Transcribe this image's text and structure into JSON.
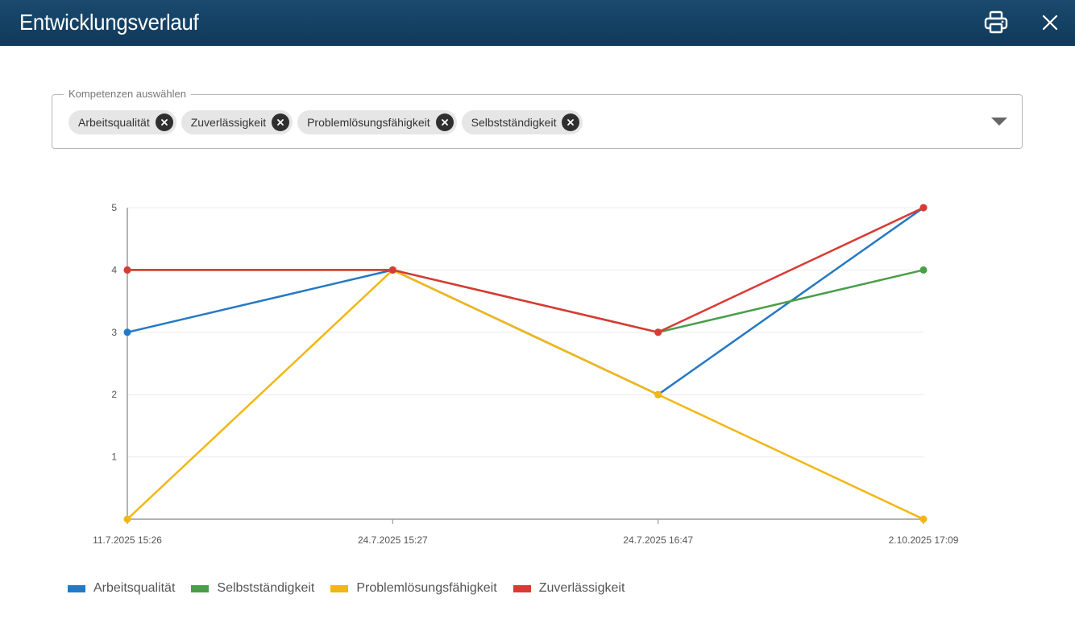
{
  "header": {
    "title": "Entwicklungsverlauf",
    "print_icon": "printer-icon",
    "close_icon": "close-icon"
  },
  "selector": {
    "legend": "Kompetenzen auswählen",
    "chips": [
      {
        "label": "Arbeitsqualität"
      },
      {
        "label": "Zuverlässigkeit"
      },
      {
        "label": "Problemlösungsfähigkeit"
      },
      {
        "label": "Selbstständigkeit"
      }
    ],
    "dropdown_icon": "triangle-down-icon"
  },
  "chart_data": {
    "type": "line",
    "x": [
      "11.7.2025 15:26",
      "24.7.2025 15:27",
      "24.7.2025 16:47",
      "2.10.2025 17:09"
    ],
    "ylim": [
      0,
      5
    ],
    "yticks": [
      "1",
      "2",
      "3",
      "4",
      "5"
    ],
    "grid": true,
    "legend_position": "bottom-left",
    "series": [
      {
        "name": "Arbeitsqualität",
        "color": "#2579c4",
        "values": [
          3,
          4,
          2,
          5
        ]
      },
      {
        "name": "Selbstständigkeit",
        "color": "#4a9e48",
        "values": [
          4,
          4,
          3,
          4
        ]
      },
      {
        "name": "Problemlösungsfähigkeit",
        "color": "#f2b713",
        "values": [
          0,
          4,
          2,
          0
        ]
      },
      {
        "name": "Zuverlässigkeit",
        "color": "#d93a34",
        "values": [
          4,
          4,
          3,
          5
        ]
      }
    ]
  }
}
